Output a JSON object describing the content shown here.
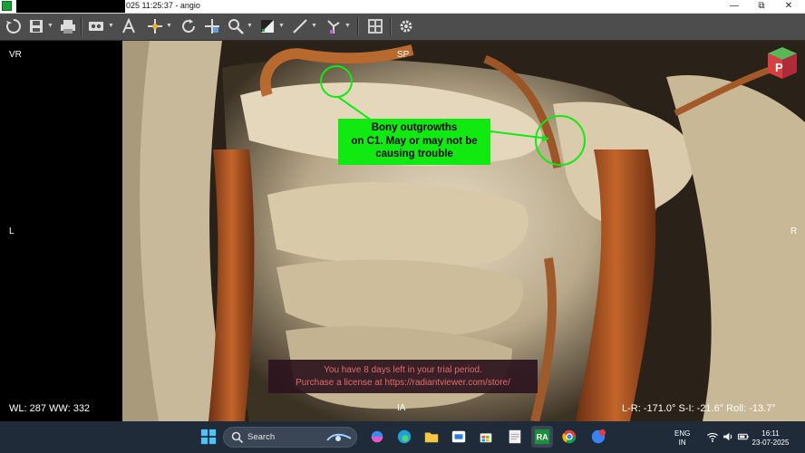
{
  "window": {
    "title": "025 11:25:37 - angio",
    "controls": {
      "minimize": "—",
      "maximize": "⧉",
      "close": "✕"
    }
  },
  "toolbar": {
    "icons": [
      "sync-icon",
      "save-icon",
      "print-icon",
      "view-mode-icon",
      "text-annotation-icon",
      "pan-icon",
      "rotate-icon",
      "crosshair-icon",
      "zoom-icon",
      "window-level-icon",
      "measure-icon",
      "angle-icon",
      "layout-icon",
      "settings-icon"
    ]
  },
  "viewport": {
    "labels": {
      "top_left": "VR",
      "top_center": "SP",
      "left": "L",
      "right": "R",
      "bottom_center": "IA",
      "window_level": "WL: 287 WW: 332",
      "orientation": "L-R: -171.0° S-I: -21.6° Roll: -13.7°"
    },
    "annotation": {
      "line1": "Bony outgrowths",
      "line2": "on C1. May or may not be",
      "line3": "causing trouble",
      "color": "#11ea11"
    },
    "trial_notice": {
      "line1": "You have 8 days left in your trial period.",
      "line2": "Purchase a license at https://radiantviewer.com/store/",
      "color": "#e26a6a"
    },
    "orientation_cube_label": "P"
  },
  "taskbar": {
    "search_placeholder": "Search",
    "language_line1": "ENG",
    "language_line2": "IN",
    "time": "16:11",
    "date": "23-07-2025",
    "apps": [
      "windows-start-icon",
      "search-icon",
      "copilot-icon",
      "edge-icon",
      "file-explorer-icon",
      "store-icon",
      "store-bag-icon",
      "notepad-icon",
      "radiant-icon",
      "chrome-icon",
      "messenger-icon"
    ]
  }
}
